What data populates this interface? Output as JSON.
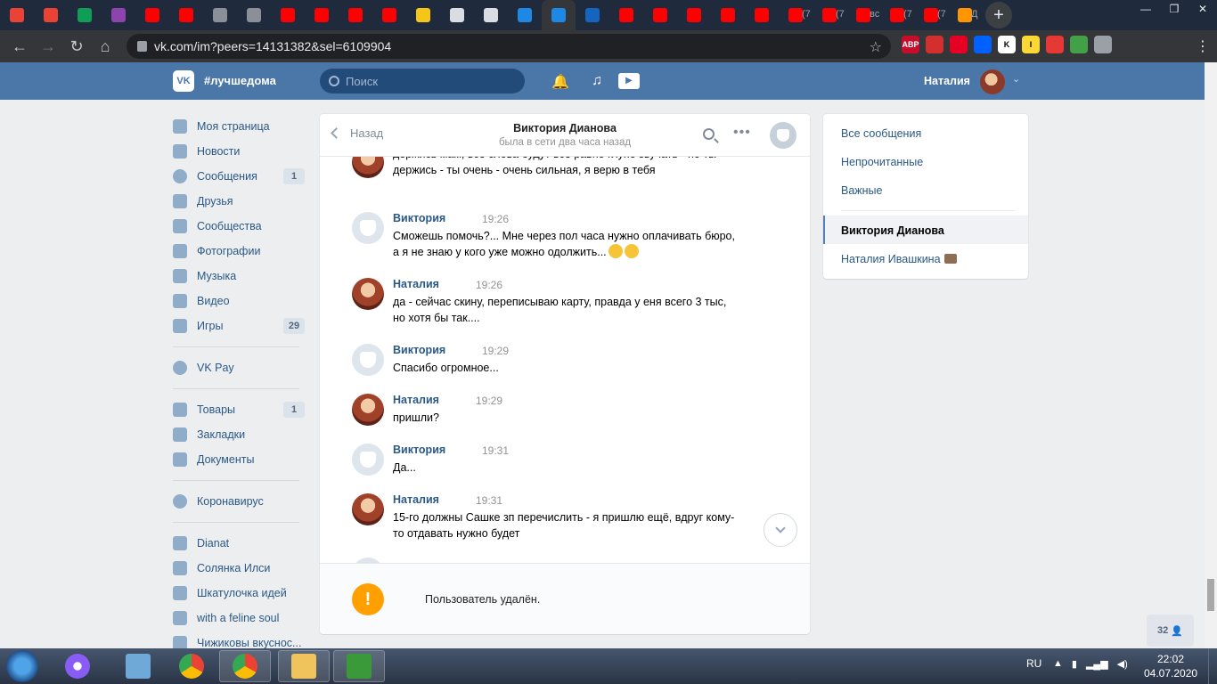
{
  "browser": {
    "tabs": [
      {
        "icon": "mail-icon",
        "color": "#ea4335",
        "label": ""
      },
      {
        "icon": "gmail-icon",
        "color": "#ea4335",
        "label": ""
      },
      {
        "icon": "sheets-icon",
        "color": "#0f9d58",
        "label": ""
      },
      {
        "icon": "s-icon",
        "color": "#8e44ad",
        "label": ""
      },
      {
        "icon": "youtube-icon",
        "color": "#ff0000",
        "label": ""
      },
      {
        "icon": "youtube-icon",
        "color": "#ff0000",
        "label": ""
      },
      {
        "icon": "globe-icon",
        "color": "#8a8f98",
        "label": ""
      },
      {
        "icon": "globe-icon",
        "color": "#8a8f98",
        "label": ""
      },
      {
        "icon": "youtube-icon",
        "color": "#ff0000",
        "label": ""
      },
      {
        "icon": "youtube-icon",
        "color": "#ff0000",
        "label": ""
      },
      {
        "icon": "youtube-icon",
        "color": "#ff0000",
        "label": ""
      },
      {
        "icon": "youtube-icon",
        "color": "#ff0000",
        "label": ""
      },
      {
        "icon": "bulb-icon",
        "color": "#f5c518",
        "label": ""
      },
      {
        "icon": "puzzle-icon",
        "color": "#d9dce0",
        "label": ""
      },
      {
        "icon": "puzzle-icon",
        "color": "#d9dce0",
        "label": ""
      },
      {
        "icon": "arrow-icon",
        "color": "#1e88e5",
        "label": ""
      },
      {
        "icon": "chat-icon",
        "color": "#1e88e5",
        "label": ""
      },
      {
        "icon": "channel-one-icon",
        "color": "#1565c0",
        "label": ""
      },
      {
        "icon": "youtube-icon",
        "color": "#ff0000",
        "label": ""
      },
      {
        "icon": "youtube-icon",
        "color": "#ff0000",
        "label": ""
      },
      {
        "icon": "youtube-icon",
        "color": "#ff0000",
        "label": ""
      },
      {
        "icon": "youtube-icon",
        "color": "#ff0000",
        "label": ""
      },
      {
        "icon": "youtube-icon",
        "color": "#ff0000",
        "label": ""
      },
      {
        "icon": "youtube-icon",
        "color": "#ff0000",
        "label": "(7"
      },
      {
        "icon": "youtube-icon",
        "color": "#ff0000",
        "label": "(7"
      },
      {
        "icon": "yandex-icon",
        "color": "#ff0000",
        "label": "вс"
      },
      {
        "icon": "youtube-icon",
        "color": "#ff0000",
        "label": "(7"
      },
      {
        "icon": "youtube-icon",
        "color": "#ff0000",
        "label": "(7"
      },
      {
        "icon": "firefox-icon",
        "color": "#ff9500",
        "label": "Д"
      }
    ],
    "url": "vk.com/im?peers=14131382&sel=6109904",
    "extensions": [
      {
        "icon": "abp-icon",
        "color": "#c70d2c",
        "label": "ABP"
      },
      {
        "icon": "stop-hand-icon",
        "color": "#d32f2f",
        "label": ""
      },
      {
        "icon": "pinterest-icon",
        "color": "#e60023",
        "label": ""
      },
      {
        "icon": "dropbox-icon",
        "color": "#0061ff",
        "label": ""
      },
      {
        "icon": "k-icon",
        "color": "#ffffff",
        "label": "K"
      },
      {
        "icon": "i-icon",
        "color": "#fdd835",
        "label": "I"
      },
      {
        "icon": "video-dl-icon",
        "color": "#e53935",
        "label": ""
      },
      {
        "icon": "shield-icon",
        "color": "#43a047",
        "label": ""
      },
      {
        "icon": "puzzle-icon",
        "color": "#9aa0a6",
        "label": ""
      }
    ]
  },
  "vk_header": {
    "logo": "VK",
    "hashtag": "#лучшедома",
    "search_placeholder": "Поиск",
    "user_name": "Наталия"
  },
  "left_nav": [
    {
      "label": "Моя страница",
      "icon": "home-icon",
      "count": ""
    },
    {
      "label": "Новости",
      "icon": "news-icon",
      "count": ""
    },
    {
      "label": "Сообщения",
      "icon": "messages-icon",
      "count": "1"
    },
    {
      "label": "Друзья",
      "icon": "friends-icon",
      "count": ""
    },
    {
      "label": "Сообщества",
      "icon": "groups-icon",
      "count": ""
    },
    {
      "label": "Фотографии",
      "icon": "camera-icon",
      "count": ""
    },
    {
      "label": "Музыка",
      "icon": "music-icon",
      "count": ""
    },
    {
      "label": "Видео",
      "icon": "video-icon",
      "count": ""
    },
    {
      "label": "Игры",
      "icon": "gamepad-icon",
      "count": "29"
    },
    {
      "label": "VK Pay",
      "icon": "vkpay-icon",
      "count": ""
    },
    {
      "label": "Товары",
      "icon": "shopping-bag-icon",
      "count": "1"
    },
    {
      "label": "Закладки",
      "icon": "star-icon",
      "count": ""
    },
    {
      "label": "Документы",
      "icon": "document-icon",
      "count": ""
    },
    {
      "label": "Коронавирус",
      "icon": "virus-icon",
      "count": ""
    },
    {
      "label": "Dianat",
      "icon": "group-icon",
      "count": ""
    },
    {
      "label": "Солянка Илси",
      "icon": "group-icon",
      "count": ""
    },
    {
      "label": "Шкатулочка идей",
      "icon": "group-icon",
      "count": ""
    },
    {
      "label": "with a feline soul",
      "icon": "group-icon",
      "count": ""
    },
    {
      "label": "Чижиковы вкуснос...",
      "icon": "group-icon",
      "count": ""
    }
  ],
  "chat": {
    "back_label": "Назад",
    "contact_name": "Виктория Дианова",
    "contact_status": "была в сети два часа назад",
    "messages": [
      {
        "author": "",
        "time": "",
        "text": "держись мам, все слова будут всё равно глупо звучать - но ты держись - ты очень - очень сильная, я верю в тебя",
        "avatar": "photo"
      },
      {
        "author": "Виктория",
        "time": "19:26",
        "text": "Сможешь помочь?... Мне через пол часа нужно оплачивать бюро, а я не знаю у кого уже можно одолжить...",
        "avatar": "deleted"
      },
      {
        "author": "Наталия",
        "time": "19:26",
        "text": "да - сейчас скину, переписываю карту, правда у еня всего 3 тыс, но хотя бы так....",
        "avatar": "photo"
      },
      {
        "author": "Виктория",
        "time": "19:29",
        "text": "Спасибо огромное...",
        "avatar": "deleted"
      },
      {
        "author": "Наталия",
        "time": "19:29",
        "text": "пришли?",
        "avatar": "photo"
      },
      {
        "author": "Виктория",
        "time": "19:31",
        "text": "Да...",
        "avatar": "deleted"
      },
      {
        "author": "Наталия",
        "time": "19:31",
        "text": "15-го должны Сашке зп перечислить - я пришлю ещё, вдруг кому-то отдавать нужно будет",
        "avatar": "photo"
      }
    ],
    "notice": "Пользователь удалён."
  },
  "right_panel": {
    "filters": [
      "Все сообщения",
      "Непрочитанные",
      "Важные"
    ],
    "conversations": [
      "Виктория Дианова",
      "Наталия Ивашкина"
    ]
  },
  "online_count": "32",
  "taskbar": {
    "lang": "RU",
    "time": "22:02",
    "date": "04.07.2020"
  }
}
